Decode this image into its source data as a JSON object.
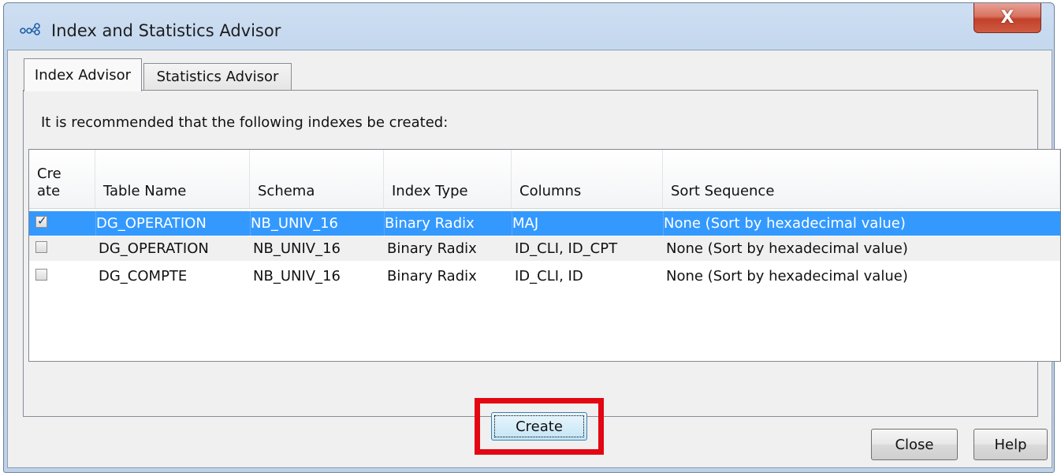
{
  "window": {
    "title": "Index and Statistics Advisor",
    "close_glyph": "X"
  },
  "tabs": [
    {
      "label": "Index Advisor",
      "active": true
    },
    {
      "label": "Statistics Advisor",
      "active": false
    }
  ],
  "panel": {
    "recommendation_text": "It is recommended that the following indexes be created:"
  },
  "table": {
    "headers": {
      "create_line1": "Cre",
      "create_line2": "ate",
      "table_name": "Table Name",
      "schema": "Schema",
      "index_type": "Index Type",
      "columns": "Columns",
      "sort_sequence": "Sort Sequence"
    },
    "rows": [
      {
        "checked": true,
        "selected": true,
        "table_name": "DG_OPERATION",
        "schema": "NB_UNIV_16",
        "index_type": "Binary Radix",
        "columns": "MAJ",
        "sort_sequence": "None (Sort by hexadecimal value)"
      },
      {
        "checked": false,
        "selected": false,
        "table_name": "DG_OPERATION",
        "schema": "NB_UNIV_16",
        "index_type": "Binary Radix",
        "columns": "ID_CLI, ID_CPT",
        "sort_sequence": "None (Sort by hexadecimal value)"
      },
      {
        "checked": false,
        "selected": false,
        "table_name": "DG_COMPTE",
        "schema": "NB_UNIV_16",
        "index_type": "Binary Radix",
        "columns": "ID_CLI, ID",
        "sort_sequence": "None (Sort by hexadecimal value)"
      }
    ]
  },
  "buttons": {
    "create": "Create",
    "close": "Close",
    "help": "Help"
  },
  "colors": {
    "selection": "#3399ff",
    "highlight_frame": "#e30613"
  },
  "icons": {
    "app": "index-advisor-app-icon",
    "close": "window-close-icon",
    "check": "checkmark-icon"
  }
}
